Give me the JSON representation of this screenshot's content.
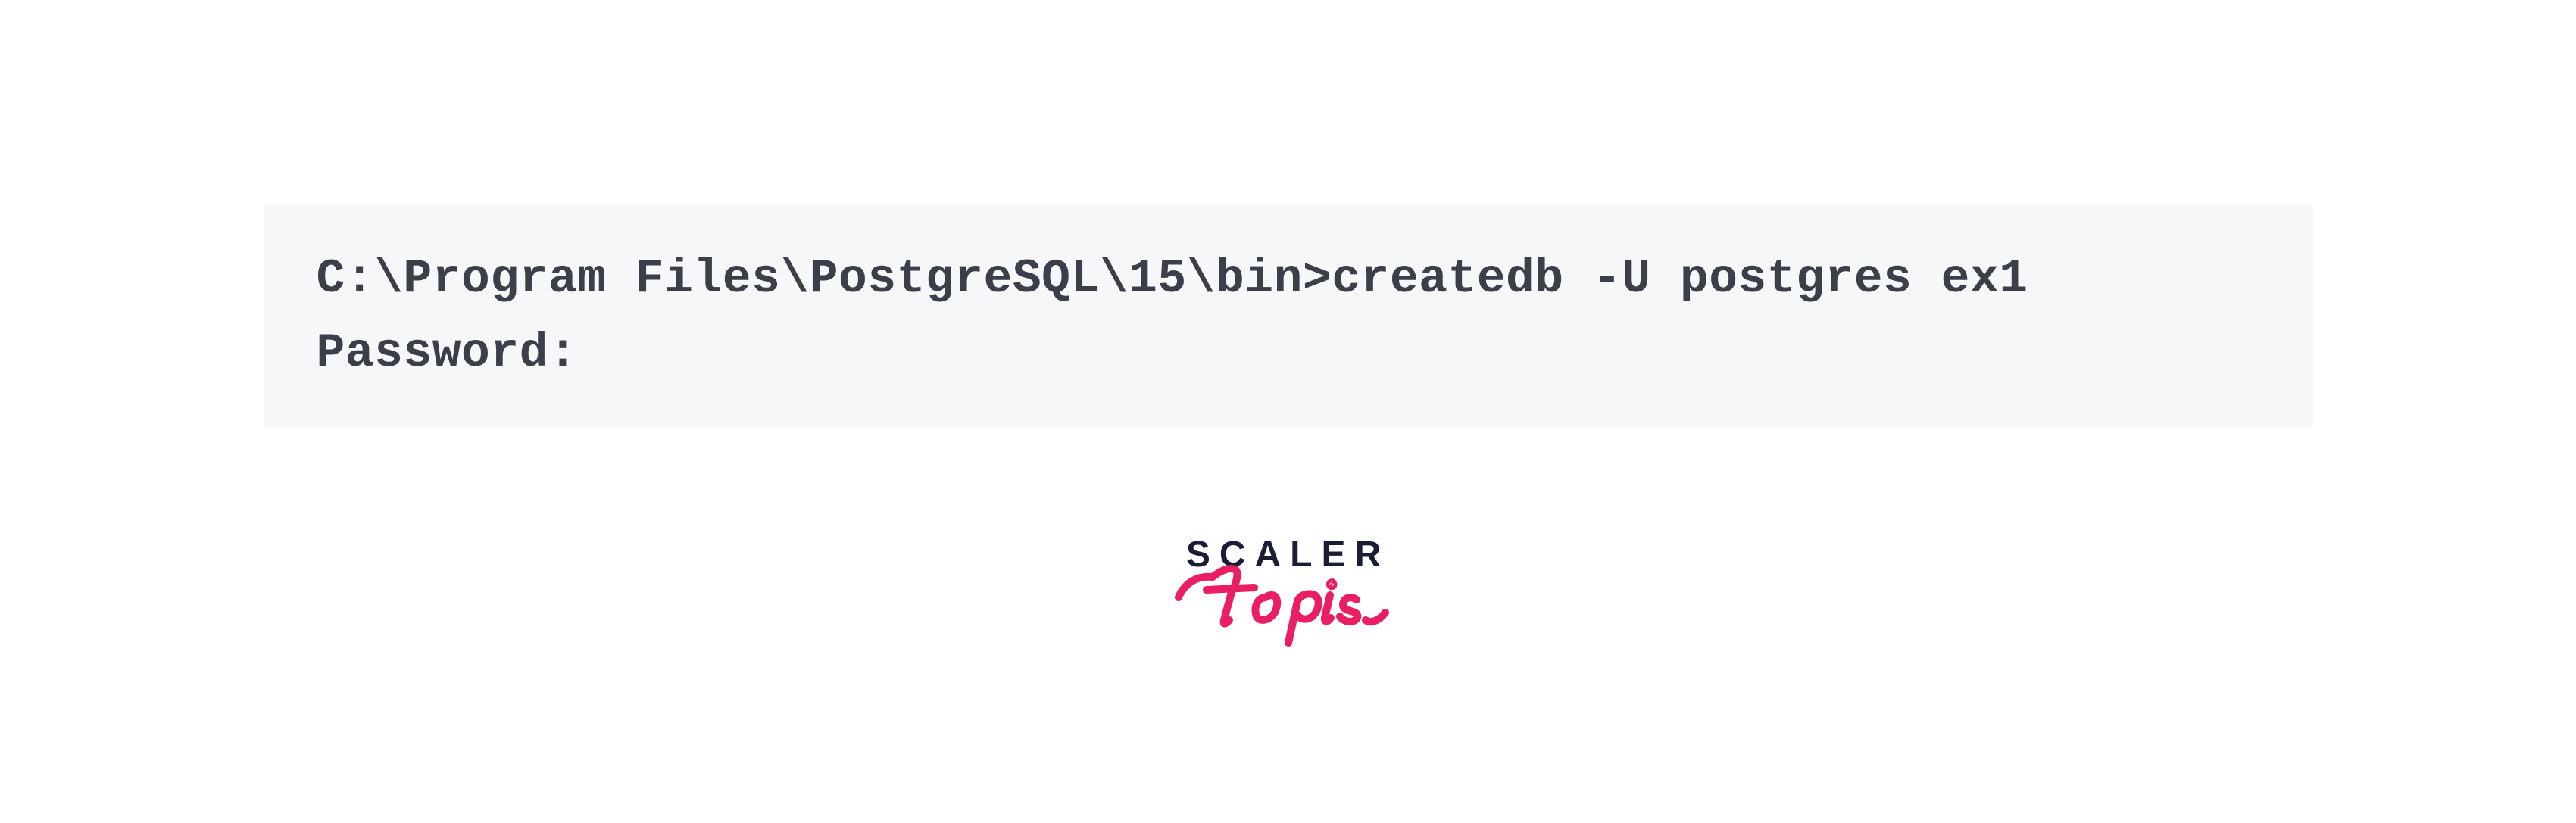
{
  "code": {
    "line1": "C:\\Program Files\\PostgreSQL\\15\\bin>createdb -U postgres ex1",
    "line2": "Password:"
  },
  "logo": {
    "scaler_text": "SCALER",
    "topics_text": "Topics",
    "scaler_color": "#1a1e35",
    "topics_color": "#e91e63"
  }
}
